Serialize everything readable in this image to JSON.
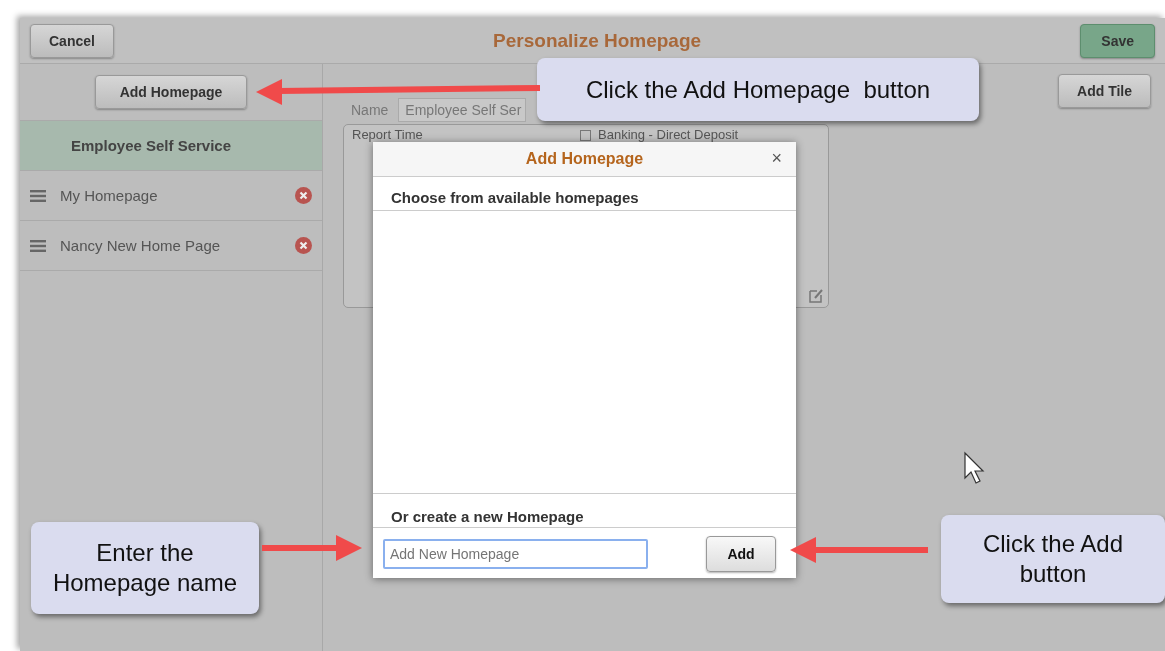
{
  "header": {
    "cancel": "Cancel",
    "title": "Personalize Homepage",
    "save": "Save"
  },
  "sidebar": {
    "add_button": "Add Homepage",
    "items": [
      {
        "label": "Employee Self Service",
        "selected": true
      },
      {
        "label": "My Homepage",
        "selected": false
      },
      {
        "label": "Nancy New Home Page",
        "selected": false
      }
    ]
  },
  "content": {
    "name_label": "Name",
    "name_value": "Employee Self Ser",
    "add_tile": "Add Tile",
    "tiles": [
      {
        "label": "Report Time"
      },
      {
        "label": "Banking - Direct Deposit",
        "checked": false
      }
    ]
  },
  "dialog": {
    "title": "Add Homepage",
    "close": "×",
    "choose_heading": "Choose from available homepages",
    "create_heading": "Or create a new Homepage",
    "input": {
      "placeholder": "Add New Homepage"
    },
    "add_button": "Add"
  },
  "callouts": [
    "Click the Add Homepage  button",
    "Enter the Homepage name",
    "Click the Add button"
  ]
}
